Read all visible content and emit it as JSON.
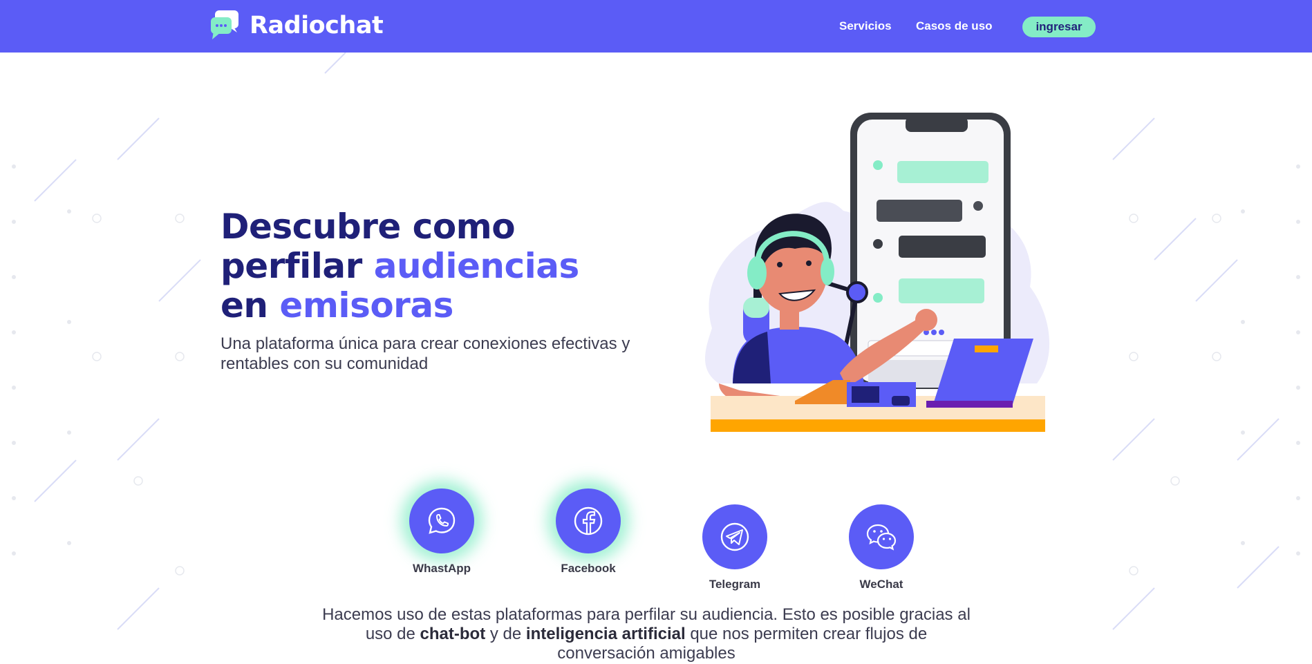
{
  "header": {
    "brand": "Radiochat",
    "brand_icon": "chat-bubble-logo-icon",
    "nav": [
      {
        "label": "Servicios"
      },
      {
        "label": "Casos de uso"
      }
    ],
    "login_label": "ingresar"
  },
  "hero": {
    "title_line1": "Descubre como",
    "title_line2_a": "perfilar ",
    "title_line2_b": "audiencias",
    "title_line3_a": "en ",
    "title_line3_b": "emisoras",
    "subtitle": "Una plataforma única para crear conexiones efectivas y rentables con su comunidad",
    "illustration": "radio-host-with-phone-chat-illustration"
  },
  "platforms": [
    {
      "name": "WhastApp",
      "icon": "whatsapp-icon",
      "highlighted": true
    },
    {
      "name": "Facebook",
      "icon": "facebook-icon",
      "highlighted": true
    },
    {
      "name": "Telegram",
      "icon": "telegram-icon",
      "highlighted": false
    },
    {
      "name": "WeChat",
      "icon": "wechat-icon",
      "highlighted": false
    }
  ],
  "description": {
    "part1": "Hacemos uso de estas plataformas para perfilar su audiencia. Esto es posible gracias al uso de ",
    "bold1": "chat-bot",
    "part2": " y de ",
    "bold2": "inteligencia artificial",
    "part3": " que nos permiten crear flujos de conversación amigables"
  },
  "colors": {
    "primary": "#5b5cf6",
    "navy": "#1f2078",
    "mint": "#84ecc6",
    "orange": "#ffa500"
  }
}
